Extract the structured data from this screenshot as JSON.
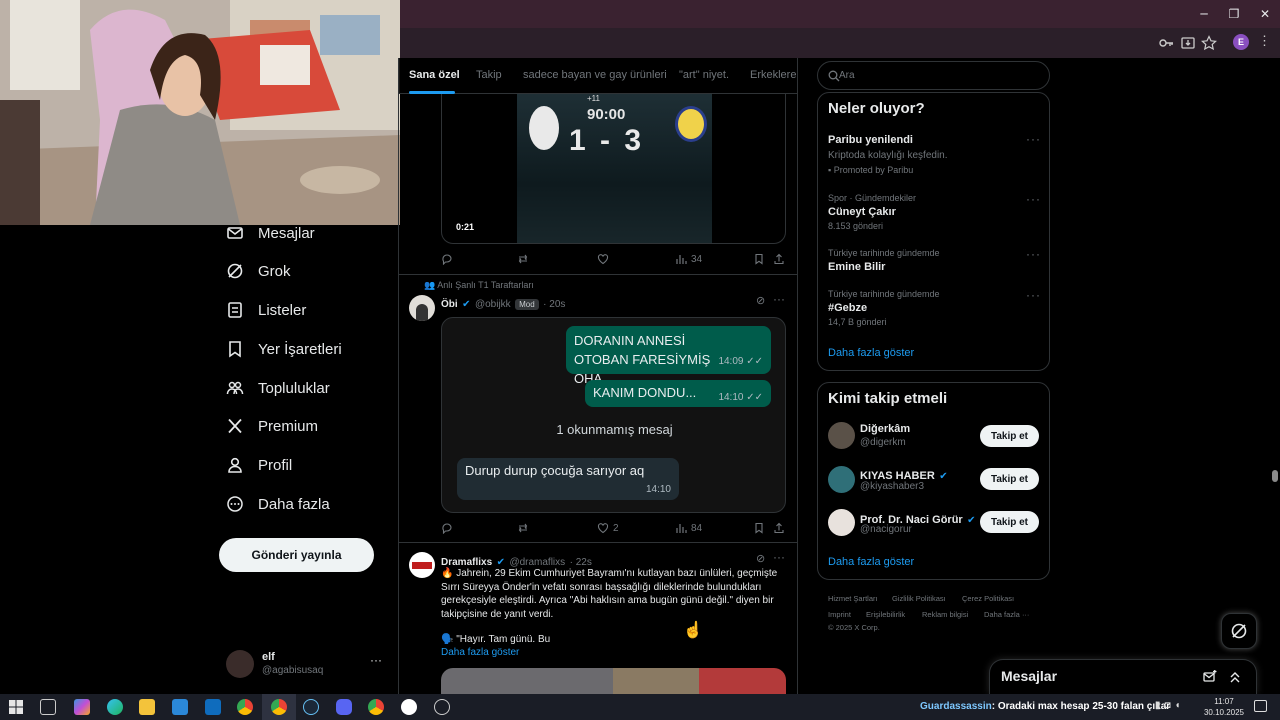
{
  "browser": {
    "window_controls": {
      "minimize": "─",
      "maximize": "❐",
      "close": "✕"
    },
    "profile_initial": "E"
  },
  "nav": {
    "items": [
      {
        "label": "Mesajlar",
        "icon": "mail-icon"
      },
      {
        "label": "Grok",
        "icon": "grok-icon"
      },
      {
        "label": "Listeler",
        "icon": "list-icon"
      },
      {
        "label": "Yer İşaretleri",
        "icon": "bookmark-icon"
      },
      {
        "label": "Topluluklar",
        "icon": "communities-icon"
      },
      {
        "label": "Premium",
        "icon": "x-logo-icon"
      },
      {
        "label": "Profil",
        "icon": "profile-icon"
      },
      {
        "label": "Daha fazla",
        "icon": "more-circle-icon"
      }
    ],
    "post_button": "Gönderi yayınla",
    "account": {
      "name": "elf",
      "handle": "@agabisusaq",
      "more": "···"
    }
  },
  "tabs": [
    "Sana özel",
    "Takip",
    "sadece bayan ve gay ürünleri",
    "\"art\" niyet.",
    "Erkeklere"
  ],
  "post1": {
    "video_time": "0:21",
    "score": "1 - 3",
    "clock": "90:00",
    "added": "+11",
    "views": "34"
  },
  "post2": {
    "context": "Anlı Şanlı T1 Taraftarları",
    "name": "Öbi",
    "handle": "@obijkk",
    "badge": "Mod",
    "time": "· 20s",
    "bubbles": [
      {
        "text": "DORANIN ANNESİ OTOBAN FARESİYMİŞ OHA",
        "time": "14:09 ✓✓"
      },
      {
        "text": "KANIM DONDU...",
        "time": "14:10 ✓✓"
      }
    ],
    "unread": "1 okunmamış mesaj",
    "incoming": {
      "text": "Durup durup çocuğa sarıyor aq",
      "time": "14:10"
    },
    "likes": "2",
    "views": "84"
  },
  "post3": {
    "name": "Dramaflixs",
    "handle": "@dramaflixs",
    "time": "· 22s",
    "text": "🔥 Jahrein, 29 Ekim Cumhuriyet Bayramı'nı kutlayan bazı ünlüleri, geçmişte Sırrı Süreyya Önder'in vefatı sonrası başsağlığı dileklerinde bulundukları gerekçesiyle eleştirdi. Ayrıca \"Abi haklısın ama bugün günü değil.\" diyen bir takipçisine de yanıt verdi.",
    "quote": "🗣️ \"Hayır. Tam günü. Bu",
    "show_more": "Daha fazla göster"
  },
  "search": {
    "placeholder": "Ara"
  },
  "trends": {
    "title": "Neler oluyor?",
    "items": [
      {
        "category": "",
        "name": "Paribu yenilendi",
        "sub": "Kriptoda kolaylığı keşfedin.",
        "promo": "Promoted by Paribu"
      },
      {
        "category": "Spor · Gündemdekiler",
        "name": "Cüneyt Çakır",
        "sub": "8.153 gönderi"
      },
      {
        "category": "Türkiye tarihinde gündemde",
        "name": "Emine Bilir",
        "sub": ""
      },
      {
        "category": "Türkiye tarihinde gündemde",
        "name": "#Gebze",
        "sub": "14,7 B gönderi"
      }
    ],
    "show_more": "Daha fazla göster"
  },
  "who_to_follow": {
    "title": "Kimi takip etmeli",
    "users": [
      {
        "name": "Diğerkâm",
        "handle": "@digerkm",
        "button": "Takip et"
      },
      {
        "name": "KIYAS HABER",
        "handle": "@kiyashaber3",
        "button": "Takip et"
      },
      {
        "name": "Prof. Dr. Naci Görür",
        "handle": "@nacigorur",
        "button": "Takip et"
      }
    ],
    "show_more": "Daha fazla göster"
  },
  "footer": {
    "row1": [
      "Hizmet Şartları",
      "Gizlilik Politikası",
      "Çerez Politikası"
    ],
    "row2": [
      "Imprint",
      "Erişilebilirlik",
      "Reklam bilgisi",
      "Daha fazla ···"
    ],
    "copyright": "© 2025 X Corp."
  },
  "messages_dock": {
    "title": "Mesajlar"
  },
  "taskbar": {
    "ticker_user": "Guardassassin",
    "ticker_text": ": Oradaki max hesap 25-30 falan çıkar",
    "time": "11:07",
    "date": "30.10.2025"
  },
  "colors": {
    "accent": "#1d9bf0",
    "background": "#000000",
    "whatsapp_green": "#005c4b"
  }
}
